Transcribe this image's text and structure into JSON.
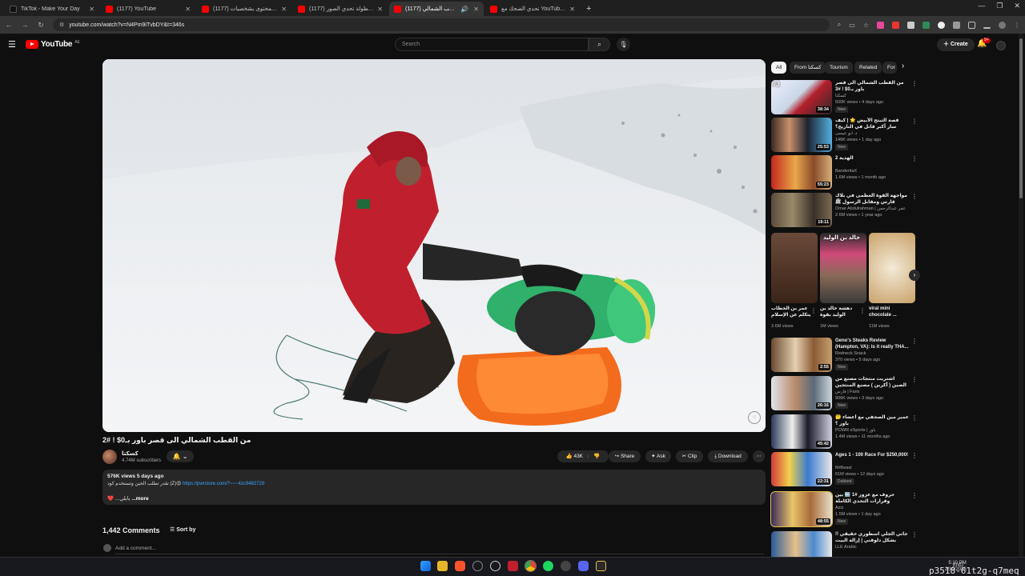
{
  "browser": {
    "tabs": [
      {
        "title": "TikTok - Make Your Day",
        "icon": "tiktok-icon",
        "active": false
      },
      {
        "title": "(1177) YouTube",
        "icon": "youtube-icon",
        "active": false
      },
      {
        "title": "(1177) صناع المحتوى بشخصيات",
        "icon": "youtube-icon",
        "active": false
      },
      {
        "title": "(1177) بطولة تحدي الصور 😵",
        "icon": "youtube-icon",
        "active": false
      },
      {
        "title": "(1177) من القطب الشمالي",
        "icon": "youtube-icon",
        "active": true
      },
      {
        "title": "تحدي الضحك مع YouTube - 😂🎯",
        "icon": "youtube-icon",
        "active": false
      }
    ],
    "new_tab": "+",
    "url": "youtube.com/watch?v=N4Pm9iTvbDY&t=346s",
    "window_controls": [
      "—",
      "❐",
      "✕"
    ]
  },
  "youtube": {
    "logo_word": "YouTube",
    "logo_country": "AE",
    "search_placeholder": "Search",
    "create_label": "Create",
    "notifications_badge": "9+"
  },
  "video": {
    "title": "من القطب الشمالي الى قصر باور بـ0$ ! #2",
    "channel": "كسكتا",
    "subscribers": "4.74M subscribers",
    "likes": "43K",
    "share": "Share",
    "ask": "Ask",
    "clip": "Clip",
    "download": "Download",
    "description": {
      "meta": "576K views  5 days ago",
      "line2_prefix": "تقدر تطلب الحين وتستخدم كود (Z)😍",
      "link": "https://pwrstore.com/?~~~4zc9482729",
      "line3_prefix": "❤️ ...بابلي",
      "more": "...more"
    }
  },
  "comments": {
    "count": "1,442 Comments",
    "sort_label": "Sort by",
    "placeholder": "Add a comment..."
  },
  "sidebar": {
    "chips": [
      "All",
      "From كسكتا",
      "Tourism",
      "Related",
      "For"
    ],
    "recs": [
      {
        "title": "من القطب الشمالي الى قصر باور بـ0$ ! #3",
        "channel": "كسكتا",
        "views": "500K views • 4 days ago",
        "badge": "New",
        "duration": "38:34",
        "rank": "#3"
      },
      {
        "title": "قصة التيتح الأبيض 🌟 | كيف سار أكبر قاتل في التاريخ؟",
        "channel": "د. أبو عيسى",
        "views": "146K views • 1 day ago",
        "badge": "New",
        "duration": "25:53",
        "rank": ""
      },
      {
        "title": "الهدية 2",
        "channel": "BanderitaX",
        "views": "1.6M views • 1 month ago",
        "badge": "",
        "duration": "55:23",
        "rank": ""
      },
      {
        "title": "مواجهة القوة العظمى في بلاك قارس ومقابل الرسول ﷺ",
        "channel": "Omar Abdulrahman | عمر عبدالرحمن",
        "views": "2.6M views • 1 year ago",
        "badge": "",
        "duration": "19:11",
        "rank": ""
      }
    ],
    "shorts": [
      {
        "title": "عمر بن الخطاب يتكلم عن الإسلام",
        "views": "3.6M views"
      },
      {
        "title": "دهشة خالد بن الوليد بقوة الرسول",
        "views": "1M views"
      },
      {
        "title": "viral mini chocolate ...",
        "views": "11M views"
      }
    ],
    "shorts_overlay_text": "خالد بن الوليد",
    "recs2": [
      {
        "title": "Geno's Steaks Review (Hampton, VA): Is it really THA...",
        "channel": "Redneck Snack",
        "views": "370 views • 5 days ago",
        "badge": "New",
        "duration": "2:55"
      },
      {
        "title": "اشتريت منتجات مصنع من الصين ( أكرين ) مصنع المنتجين !!",
        "channel": "فارس | Faris",
        "views": "906K views • 3 days ago",
        "badge": "New",
        "duration": "26:16"
      },
      {
        "title": "🤔 عمير مين الصحفي مع أعضاء باور ؟",
        "channel": "POWR eSports | باور",
        "views": "1.4M views • 11 months ago",
        "badge": "",
        "duration": "45:42"
      },
      {
        "title": "Ages 1 - 100 Race For $250,000!",
        "channel": "MrBeast",
        "views": "61M views • 12 days ago",
        "badge": "Dubbed",
        "duration": "22:31"
      },
      {
        "title": "حروف مع عزوز #1 🔤 بين وقرارات التحدي الكاملة",
        "channel": "Aziz",
        "views": "1.5M views • 1 day ago",
        "badge": "New",
        "duration": "48:55"
      },
      {
        "title": "جاني الجلي اسطوري حقيقي !! بشكل دلوقتي | إزالة البيت",
        "channel": "LLE Arabic",
        "views": "",
        "badge": "",
        "duration": ""
      }
    ]
  },
  "taskbar": {
    "time": "5:10 PM",
    "date": "2/10/2026",
    "lang": "ENG"
  },
  "overlay_text": "p3518-61t2g-q7meq"
}
